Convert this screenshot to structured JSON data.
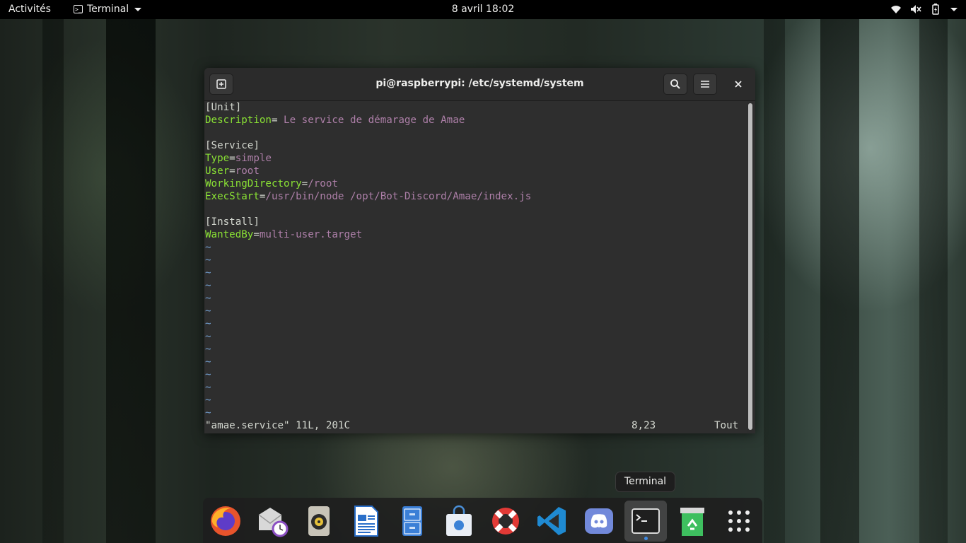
{
  "topbar": {
    "activities": "Activités",
    "app_name": "Terminal",
    "clock": "8 avril  18:02",
    "icons": [
      "wifi-icon",
      "volume-muted-icon",
      "battery-icon",
      "caret-down-icon"
    ]
  },
  "window": {
    "title": "pi@raspberrypi: /etc/systemd/system",
    "buttons": [
      "new-tab-icon",
      "search-icon",
      "menu-icon",
      "close-icon"
    ]
  },
  "editor": {
    "lines": [
      {
        "k": "",
        "eq": "",
        "v": "",
        "plain": "[Unit]"
      },
      {
        "k": "Description",
        "eq": "=",
        "v": " Le service de démarage de Amae",
        "plain": ""
      },
      {
        "k": "",
        "eq": "",
        "v": "",
        "plain": ""
      },
      {
        "k": "",
        "eq": "",
        "v": "",
        "plain": "[Service]"
      },
      {
        "k": "Type",
        "eq": "=",
        "v": "simple",
        "plain": ""
      },
      {
        "k": "User",
        "eq": "=",
        "v": "root",
        "plain": ""
      },
      {
        "k": "WorkingDirectory",
        "eq": "=",
        "v": "/root",
        "plain": ""
      },
      {
        "k": "ExecStart",
        "eq": "=",
        "v": "/usr/bin/node /opt/Bot-Discord/Amae/index.js",
        "plain": ""
      },
      {
        "k": "",
        "eq": "",
        "v": "",
        "plain": ""
      },
      {
        "k": "",
        "eq": "",
        "v": "",
        "plain": "[Install]"
      },
      {
        "k": "WantedBy",
        "eq": "=",
        "v": "multi-user.target",
        "plain": ""
      }
    ],
    "tilde": "~",
    "tilde_count": 14,
    "status_file": "\"amae.service\" 11L, 201C",
    "status_position": "8,23",
    "status_scroll": "Tout"
  },
  "tooltip": "Terminal",
  "dock": [
    {
      "name": "firefox",
      "active": false
    },
    {
      "name": "evolution-mail",
      "active": false
    },
    {
      "name": "rhythmbox",
      "active": false
    },
    {
      "name": "libreoffice-writer",
      "active": false
    },
    {
      "name": "files",
      "active": false
    },
    {
      "name": "software",
      "active": false
    },
    {
      "name": "help",
      "active": false
    },
    {
      "name": "vscode",
      "active": false
    },
    {
      "name": "discord",
      "active": false
    },
    {
      "name": "terminal",
      "active": true
    },
    {
      "name": "trash",
      "active": false
    },
    {
      "name": "show-applications",
      "active": false
    }
  ]
}
